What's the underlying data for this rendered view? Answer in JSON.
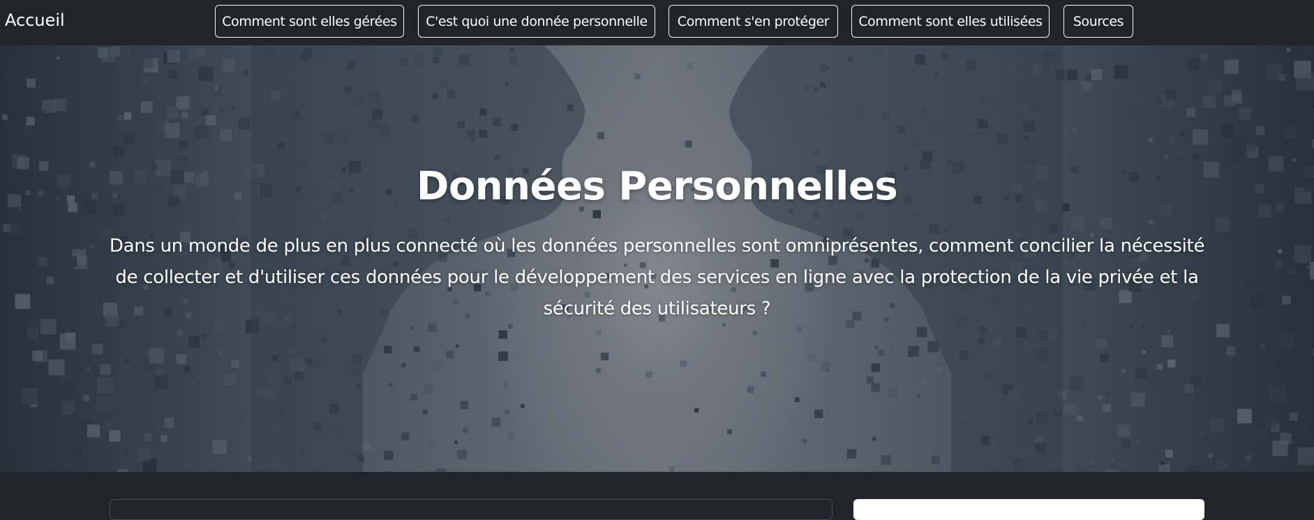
{
  "navbar": {
    "brand": "Accueil",
    "links": [
      "Comment sont elles gérées",
      "C'est quoi une donnée personnelle",
      "Comment s'en protéger",
      "Comment sont elles utilisées",
      "Sources"
    ]
  },
  "hero": {
    "title": "Données Personnelles",
    "text": "Dans un monde de plus en plus connecté où les données personnelles sont omniprésentes, comment concilier la nécessité de collecter et d'utiliser ces données pour le développement des services en ligne avec la protection de la vie privée et la sécurité des utilisateurs ?"
  },
  "colors": {
    "navbar_bg": "#212529",
    "text": "#ffffff",
    "button_border": "#f8f9fa"
  }
}
